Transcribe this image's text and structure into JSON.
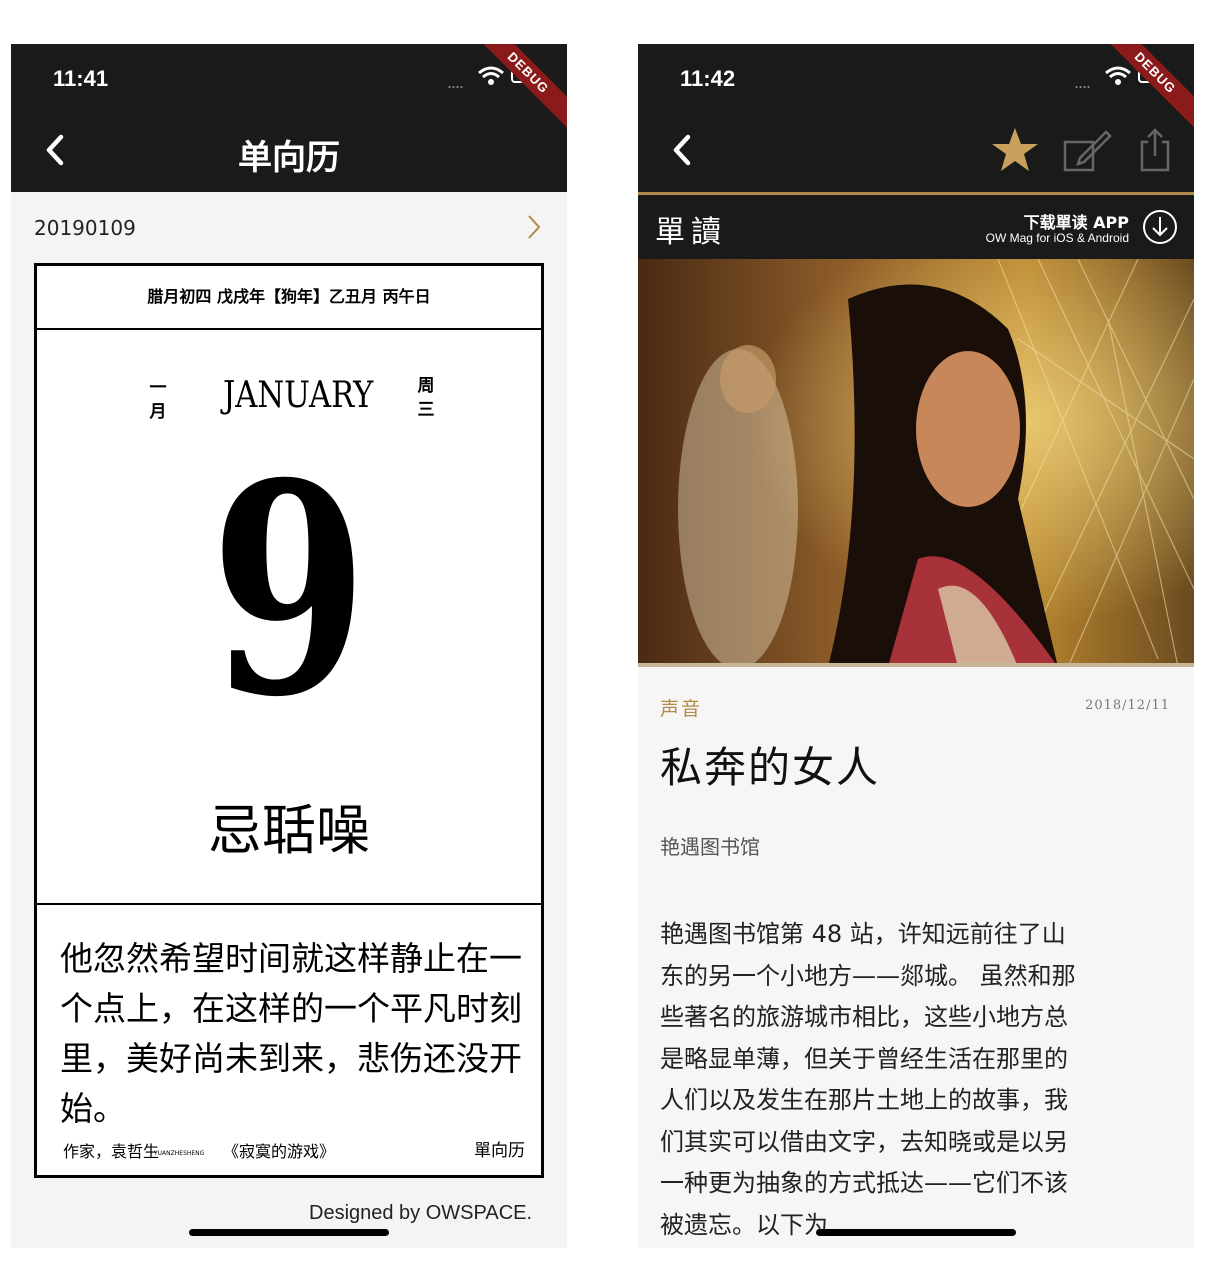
{
  "left": {
    "status": {
      "time": "11:41",
      "signal": "....",
      "debug": "DEBUG"
    },
    "nav": {
      "title": "单向历"
    },
    "date": "20190109",
    "calendar": {
      "lunar": "腊月初四 戊戌年【狗年】乙丑月 丙午日",
      "month_vertical_top": "一",
      "month_vertical_bottom": "月",
      "month_en": "JANUARY",
      "weekday_vertical_top": "周",
      "weekday_vertical_bottom": "三",
      "day": "9",
      "taboo": "忌聒噪",
      "quote": "他忽然希望时间就这样静止在一个点上，在这样的一个平凡时刻里，美好尚未到来，悲伤还没开始。",
      "author": "作家，袁哲生",
      "author_pinyin": "YUANZHESHENG",
      "book": "《寂寞的游戏》",
      "brand": "單向历"
    },
    "credit": "Designed by OWSPACE."
  },
  "right": {
    "status": {
      "time": "11:42",
      "signal": "....",
      "debug": "DEBUG"
    },
    "banner": {
      "logo": "單讀",
      "download_title": "下载單读 APP",
      "download_sub": "OW Mag for iOS & Android"
    },
    "article": {
      "category": "声音",
      "date": "2018/12/11",
      "title": "私奔的女人",
      "column": "艳遇图书馆",
      "body": "艳遇图书馆第 48 站，许知远前往了山东的另一个小地方——郯城。 虽然和那些著名的旅游城市相比，这些小地方总是略显单薄，但关于曾经生活在那里的人们以及发生在那片土地上的故事，我们其实可以借由文字，去知晓或是以另一种更为抽象的方式抵达——它们不该被遗忘。以下为"
    }
  },
  "colors": {
    "accent_gold": "#b08a4a",
    "bar_dark": "#1a1a1a",
    "debug_red": "#8b1a1a"
  }
}
